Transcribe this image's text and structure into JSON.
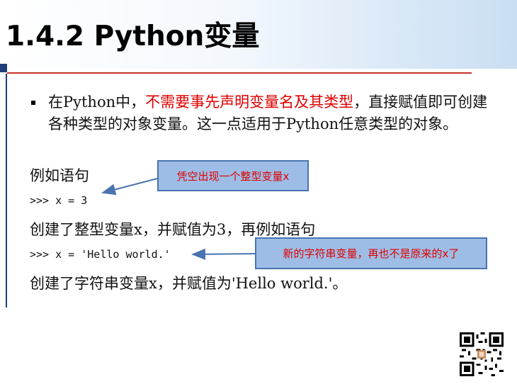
{
  "slide": {
    "title": "1.4.2 Python变量",
    "bullet": {
      "part1": "在Python中，",
      "part2_red": "不需要事先声明变量名及其类型",
      "part3": "，直接赋值即可创建各种类型的对象变量。这一点适用于Python任意类型的对象。"
    },
    "example1_label": "例如语句",
    "code1": ">>> x = 3",
    "desc1": "创建了整型变量x，并赋值为3，再例如语句",
    "code2": ">>> x = 'Hello world.'",
    "desc2": "创建了字符串变量x，并赋值为'Hello world.'。",
    "callout1": "凭空出现一个整型变量x",
    "callout2": "新的字符串变量，再也不是原来的x了"
  },
  "colors": {
    "accent_red": "#e00000",
    "callout_fill": "#9dbde6",
    "callout_border": "#4a74b0",
    "header_gradient_end": "#c9def3"
  },
  "icons": {
    "qr": "qr-code-icon"
  }
}
